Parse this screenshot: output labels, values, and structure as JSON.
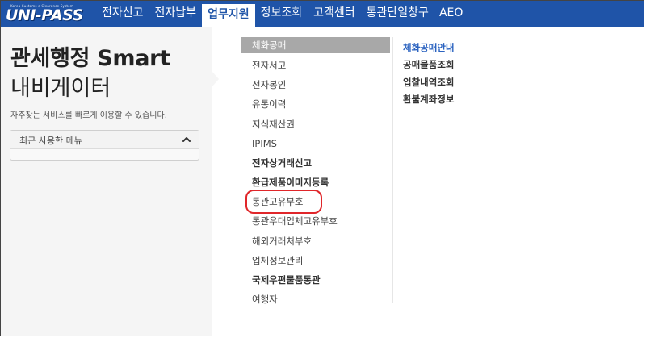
{
  "logo": {
    "tagline": "Korea Customs e-Clearance System",
    "wordmark": "UNI-PASS"
  },
  "nav": [
    {
      "label": "전자신고",
      "active": false
    },
    {
      "label": "전자납부",
      "active": false
    },
    {
      "label": "업무지원",
      "active": true
    },
    {
      "label": "정보조회",
      "active": false
    },
    {
      "label": "고객센터",
      "active": false
    },
    {
      "label": "통관단일창구",
      "active": false
    },
    {
      "label": "AEO",
      "active": false
    }
  ],
  "left": {
    "title_line1": "관세행정 Smart",
    "title_line2": "내비게이터",
    "subtitle": "자주찾는 서비스를 빠르게 이용할 수 있습니다.",
    "recent_label": "최근 사용한 메뉴"
  },
  "menu": [
    {
      "label": "체화공매",
      "selected": true,
      "bold": false
    },
    {
      "label": "전자서고",
      "selected": false,
      "bold": false
    },
    {
      "label": "전자봉인",
      "selected": false,
      "bold": false
    },
    {
      "label": "유통이력",
      "selected": false,
      "bold": false
    },
    {
      "label": "지식재산권",
      "selected": false,
      "bold": false
    },
    {
      "label": "IPIMS",
      "selected": false,
      "bold": false
    },
    {
      "label": "전자상거래신고",
      "selected": false,
      "bold": true
    },
    {
      "label": "환급제품이미지등록",
      "selected": false,
      "bold": true
    },
    {
      "label": "통관고유부호",
      "selected": false,
      "bold": false,
      "highlighted": true
    },
    {
      "label": "통관우대업체고유부호",
      "selected": false,
      "bold": false
    },
    {
      "label": "해외거래처부호",
      "selected": false,
      "bold": false
    },
    {
      "label": "업체정보관리",
      "selected": false,
      "bold": false
    },
    {
      "label": "국제우편물품통관",
      "selected": false,
      "bold": true
    },
    {
      "label": "여행자",
      "selected": false,
      "bold": false
    }
  ],
  "submenu": [
    {
      "label": "체화공매안내"
    },
    {
      "label": "공매물품조회"
    },
    {
      "label": "입찰내역조회"
    },
    {
      "label": "환불계좌정보"
    }
  ],
  "colors": {
    "nav_bg": "#1f54a8",
    "selected_bg": "#a8a8a8",
    "highlight_ring": "#e0262a",
    "submenu_first": "#2b63c0"
  },
  "icons": {
    "recent_toggle": "chevron-up-icon"
  }
}
